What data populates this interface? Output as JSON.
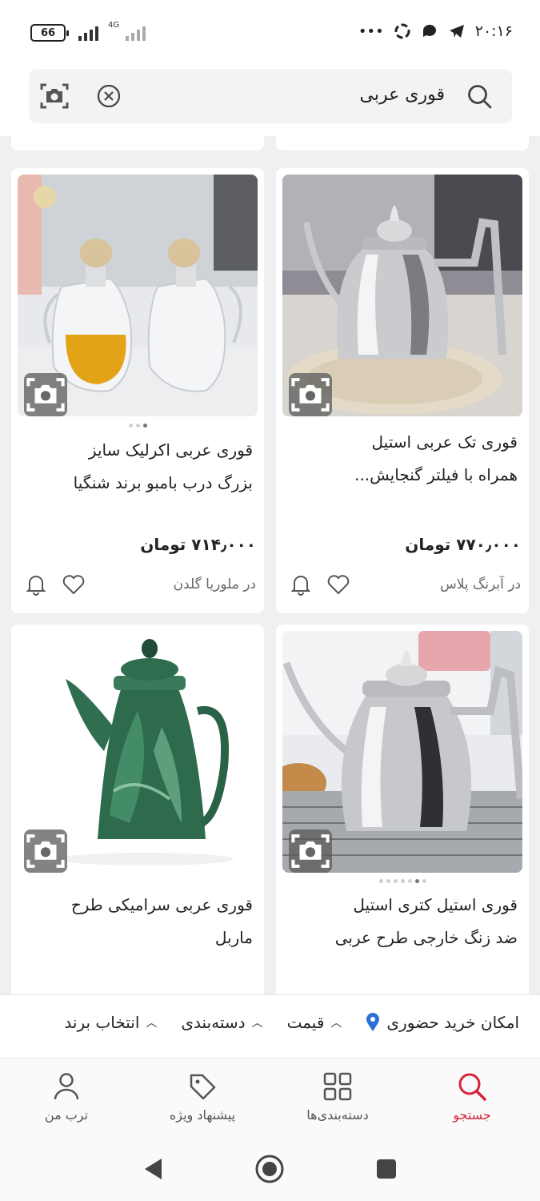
{
  "status_bar": {
    "battery": "66",
    "network": "4G",
    "time": "۲۰:۱۶",
    "more": "•••"
  },
  "search": {
    "query": "قوری عربی"
  },
  "products": [
    {
      "title_line1": "قوری تک عربی استیل",
      "title_line2": "همراه با فیلتر گنجایش...",
      "price": "۷۷۰٫۰۰۰ تومان",
      "shop": "در آبرنگ پلاس"
    },
    {
      "title_line1": "قوری عربی اکرلیک سایز",
      "title_line2": "بزرگ درب بامبو برند شنگیا",
      "price": "۷۱۴٫۰۰۰ تومان",
      "shop": "در ملوریا گلدن"
    },
    {
      "title_line1": "قوری استیل کتری استیل",
      "title_line2": "ضد زنگ خارجی طرح عربی"
    },
    {
      "title_line1": "قوری عربی سرامیکی طرح",
      "title_line2": "ماربل"
    }
  ],
  "filters": [
    {
      "label": "انتخاب برند"
    },
    {
      "label": "دسته‌بندی"
    },
    {
      "label": "قیمت"
    },
    {
      "label": "امکان خرید حضوری"
    }
  ],
  "bottom_nav": [
    {
      "label": "جستجو",
      "icon": "search-icon",
      "active": true
    },
    {
      "label": "دسته‌بندی‌ها",
      "icon": "grid-icon"
    },
    {
      "label": "پیشنهاد ویژه",
      "icon": "tag-icon"
    },
    {
      "label": "ترب من",
      "icon": "user-icon"
    }
  ],
  "colors": {
    "accent": "#d8233a",
    "grid_bg": "#eef0f2",
    "search_bg": "#f2f3f5"
  }
}
